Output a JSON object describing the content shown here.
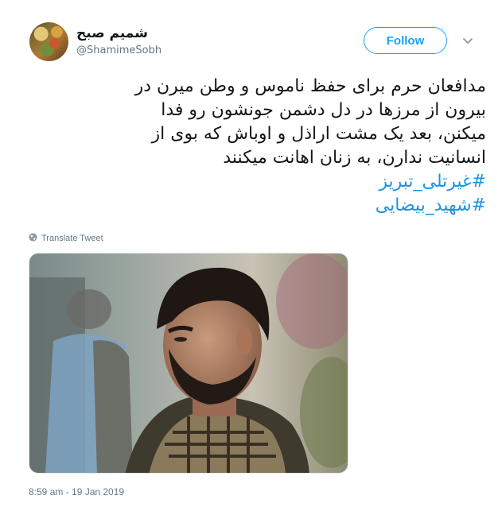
{
  "user": {
    "display_name": "شمیم صبح",
    "handle": "@ShamimeSobh"
  },
  "actions": {
    "follow_label": "Follow"
  },
  "tweet": {
    "text_lines": [
      "مدافعان حرم برای حفظ ناموس و وطن میرن در",
      "بیرون از مرزها در دل دشمن جونشون رو فدا",
      "میکنن، بعد یک مشت اراذل و اوباش که بوی از",
      "انسانیت ندارن، به زنان اهانت میکنند"
    ],
    "hashtags": [
      "#غیرتلی_تبریز",
      "#شهید_بیضایی"
    ],
    "translate_label": "Translate Tweet",
    "timestamp": "8:59 am - 19 Jan 2019"
  },
  "icons": {
    "chevron": "chevron-down-icon",
    "globe": "globe-icon"
  },
  "colors": {
    "brand_blue": "#1da1f2",
    "link_blue": "#1b95e0",
    "muted_gray": "#657786",
    "text": "#14171a"
  }
}
